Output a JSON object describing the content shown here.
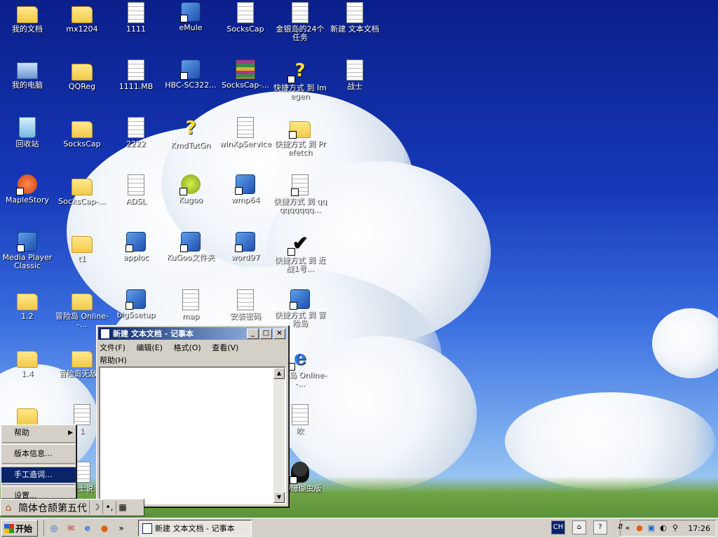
{
  "desktop_icons": [
    {
      "label": "我的文档",
      "icon": "my-documents-icon",
      "kind": "g-folder"
    },
    {
      "label": "mx1204",
      "icon": "folder-icon",
      "kind": "g-folder"
    },
    {
      "label": "1111",
      "icon": "text-file-icon",
      "kind": "g-doc"
    },
    {
      "label": "eMule",
      "icon": "emule-icon",
      "kind": "g-app",
      "shortcut": true
    },
    {
      "label": "SocksCap",
      "icon": "sockscap-icon",
      "kind": "g-doc"
    },
    {
      "label": "金银岛的24个任务",
      "icon": "text-file-icon",
      "kind": "g-doc"
    },
    {
      "label": "新建 文本文档",
      "icon": "text-file-icon",
      "kind": "g-doc"
    },
    {
      "label": "我的电脑",
      "icon": "my-computer-icon",
      "kind": "g-pc"
    },
    {
      "label": "QQReg",
      "icon": "folder-icon",
      "kind": "g-folder"
    },
    {
      "label": "1111.MB",
      "icon": "mb-file-icon",
      "kind": "g-doc"
    },
    {
      "label": "HBC-SC322...",
      "icon": "installer-icon",
      "kind": "g-app",
      "shortcut": true
    },
    {
      "label": "SocksCap-...",
      "icon": "winrar-archive-icon",
      "kind": "g-rar"
    },
    {
      "label": "快捷方式 到 Imegen",
      "icon": "imegen-icon",
      "kind": "g-q",
      "shortcut": true
    },
    {
      "label": "战士",
      "icon": "text-file-icon",
      "kind": "g-doc"
    },
    {
      "label": "回收站",
      "icon": "recycle-bin-icon",
      "kind": "g-bin"
    },
    {
      "label": "SocksCap",
      "icon": "folder-icon",
      "kind": "g-folder"
    },
    {
      "label": "2222",
      "icon": "text-file-icon",
      "kind": "g-doc"
    },
    {
      "label": "KmdTutGn",
      "icon": "help-file-icon",
      "kind": "g-q"
    },
    {
      "label": "winXpService",
      "icon": "text-file-icon",
      "kind": "g-doc"
    },
    {
      "label": "快捷方式 到 Prefetch",
      "icon": "folder-shortcut-icon",
      "kind": "g-folder",
      "shortcut": true
    },
    {
      "label": "MapleStory",
      "icon": "maplestory-icon",
      "kind": "g-red",
      "shortcut": true
    },
    {
      "label": "SocksCap-...",
      "icon": "folder-icon",
      "kind": "g-folder"
    },
    {
      "label": "ADSL",
      "icon": "adsl-icon",
      "kind": "g-doc"
    },
    {
      "label": "Kugoo",
      "icon": "kugoo-icon",
      "kind": "g-green",
      "shortcut": true
    },
    {
      "label": "wmp64",
      "icon": "wmp64-icon",
      "kind": "g-app",
      "shortcut": true
    },
    {
      "label": "快捷方式 到 qqqqqqqqq...",
      "icon": "text-file-shortcut-icon",
      "kind": "g-doc",
      "shortcut": true
    },
    {
      "label": "Media Player Classic",
      "icon": "media-player-classic-icon",
      "kind": "g-app",
      "shortcut": true
    },
    {
      "label": "t1",
      "icon": "folder-icon",
      "kind": "g-folder"
    },
    {
      "label": "apploc",
      "icon": "apploc-icon",
      "kind": "g-app",
      "shortcut": true
    },
    {
      "label": "KuGoo文件夹",
      "icon": "kugoo-folder-icon",
      "kind": "g-app",
      "shortcut": true
    },
    {
      "label": "word97",
      "icon": "word97-icon",
      "kind": "g-app",
      "shortcut": true
    },
    {
      "label": "快捷方式 到 近战1号...",
      "icon": "checkmark-shortcut-icon",
      "kind": "g-check",
      "shortcut": true
    },
    {
      "label": "1.2",
      "icon": "folder-icon",
      "kind": "g-folder"
    },
    {
      "label": "冒险岛 Online--...",
      "icon": "folder-icon",
      "kind": "g-folder"
    },
    {
      "label": "big5setup",
      "icon": "setup-icon",
      "kind": "g-app",
      "shortcut": true
    },
    {
      "label": "map",
      "icon": "text-file-icon",
      "kind": "g-doc"
    },
    {
      "label": "安装密码",
      "icon": "text-file-icon",
      "kind": "g-doc"
    },
    {
      "label": "快捷方式 到 冒险岛",
      "icon": "game-shortcut-icon",
      "kind": "g-app",
      "shortcut": true
    },
    {
      "label": "1.4",
      "icon": "folder-icon",
      "kind": "g-folder"
    },
    {
      "label": "冒险岛无敌挂",
      "icon": "folder-icon",
      "kind": "g-folder"
    },
    {
      "label": "冒险岛 Online--...",
      "icon": "internet-explorer-icon",
      "kind": "g-ie",
      "shortcut": true
    },
    {
      "label": "",
      "icon": "folder-icon",
      "kind": "g-folder"
    },
    {
      "label": "1",
      "icon": "image-file-icon",
      "kind": "g-doc"
    },
    {
      "label": "吹",
      "icon": "text-file-icon",
      "kind": "g-doc"
    },
    {
      "label": "战士说",
      "icon": "text-file-icon",
      "kind": "g-doc"
    },
    {
      "label": "QQ珊瑚虫版",
      "icon": "qq-penguin-icon",
      "kind": "g-qq",
      "shortcut": true
    }
  ],
  "notepad": {
    "title": "新建 文本文档 - 记事本",
    "menus": [
      "文件(F)",
      "编辑(E)",
      "格式(O)",
      "查看(V)",
      "帮助(H)"
    ],
    "content": ""
  },
  "context_menu": {
    "items": [
      {
        "label": "帮助",
        "submenu": true
      },
      {
        "label": "版本信息..."
      },
      {
        "label": "手工造词...",
        "selected": true
      },
      {
        "label": "设置..."
      }
    ]
  },
  "ime": {
    "name": "简体仓颉第五代",
    "half_width_symbol": "☽",
    "punct_symbol": "•,",
    "keyboard_symbol": "▦"
  },
  "taskbar": {
    "start_label": "开始",
    "overflow_label": "»",
    "task_title": "新建 文本文档 - 记事本",
    "lang": "CH",
    "tray_overflow": "«",
    "clock": "17:26"
  }
}
